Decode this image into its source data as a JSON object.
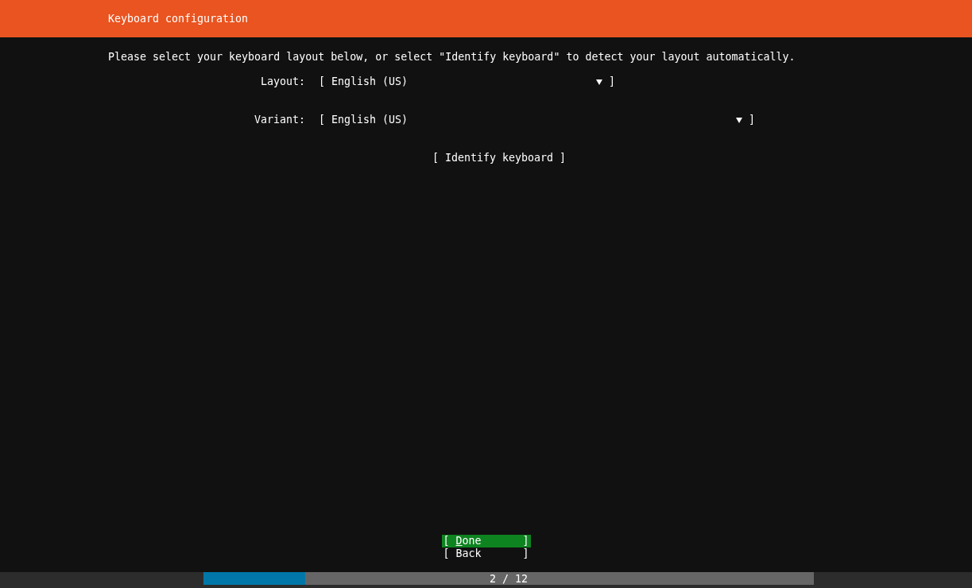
{
  "header": {
    "title": "Keyboard configuration"
  },
  "intro": "Please select your keyboard layout below, or select \"Identify keyboard\" to detect your layout automatically.",
  "fields": [
    {
      "label": "Layout:",
      "left": "[",
      "value": "English (US)",
      "right": "]"
    },
    {
      "label": "Variant:",
      "left": "[",
      "value": "English (US)",
      "right": "]"
    }
  ],
  "identify_button": {
    "left": "[",
    "label": "Identify keyboard",
    "right": "]"
  },
  "buttons": [
    {
      "left": "[",
      "label": "Done",
      "right": "]",
      "selected": true
    },
    {
      "left": "[",
      "label": "Back",
      "right": "]",
      "selected": false
    }
  ],
  "progress": {
    "level": 0.1667,
    "text": "2 / 12"
  }
}
